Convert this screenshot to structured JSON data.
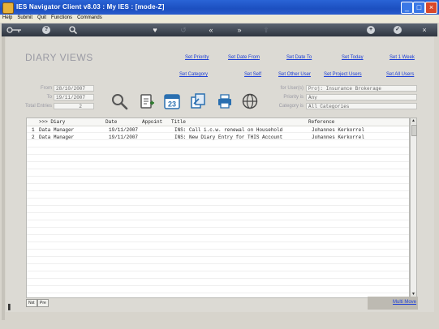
{
  "window": {
    "title": "IES Navigator Client v8.03 : My IES :     [mode-Z]"
  },
  "menu": [
    "Help",
    "Submit",
    "Quit",
    "Functions",
    "Commands"
  ],
  "toolbar": {
    "icons": [
      "key-icon",
      "help-icon",
      "search-icon",
      "heart-icon",
      "history-icon",
      "back-icon",
      "forward-icon",
      "bookmark-icon",
      "new-icon",
      "ok-icon",
      "close-icon"
    ]
  },
  "page": {
    "heading": "DIARY VIEWS"
  },
  "links": {
    "set_priority": "Set Priority",
    "set_date_from": "Set Date From",
    "set_date_to": "Set Date To",
    "set_today": "Set Today",
    "set_1_week": "Set 1 Week",
    "set_category": "Set Category",
    "set_self": "Set Self",
    "set_other_user": "Set Other User",
    "set_project_users": "Set Project Users",
    "set_all_users": "Set All Users"
  },
  "filters": {
    "from_label": "From",
    "from_value": "28/10/2007",
    "to_label": "To",
    "to_value": "19/11/2007",
    "total_label": "Total Entries",
    "total_value": "2",
    "for_users_label": "for User(s)",
    "for_users_value": "Proj: Insurance Brokerage",
    "priority_label": "Priority is",
    "priority_value": "Any",
    "category_label": "Category is",
    "category_value": "All Categories"
  },
  "grid": {
    "columns": [
      ">>> Diary",
      "Date",
      "Appoint",
      "Title",
      "Reference"
    ],
    "rows": [
      {
        "num": "1",
        "diary": "Data Manager",
        "date": "19/11/2007",
        "appoint": "",
        "title": "INS: Call i.c.w. renewal on Household",
        "reference": "Johannes Kerkorrel"
      },
      {
        "num": "2",
        "diary": "Data Manager",
        "date": "19/11/2007",
        "appoint": "",
        "title": "INS: New Diary Entry for THIS Account",
        "reference": "Johannes Kerkorrel"
      }
    ]
  },
  "paging": {
    "next_label": "Nxt",
    "prev_label": "Pre"
  },
  "actions": {
    "multi_move": "Multi Move"
  },
  "colors": {
    "title_bar": "#2a64d6",
    "link": "#1d3fd6",
    "label_grey": "#9a9aa4"
  }
}
